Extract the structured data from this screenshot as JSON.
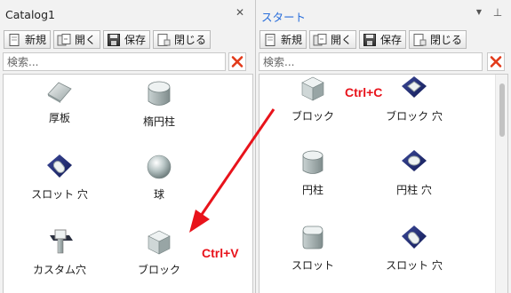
{
  "left_panel": {
    "title": "Catalog1",
    "close_glyph": "✕",
    "toolbar": [
      {
        "label": "新規",
        "icon": "new-icon"
      },
      {
        "label": "開く",
        "icon": "open-icon"
      },
      {
        "label": "保存",
        "icon": "save-icon"
      },
      {
        "label": "閉じる",
        "icon": "close-doc-icon"
      }
    ],
    "search_placeholder": "検索...",
    "items": [
      {
        "label": "厚板",
        "icon": "thick-plate-icon"
      },
      {
        "label": "楕円柱",
        "icon": "elliptic-cylinder-icon"
      },
      {
        "label": "スロット 穴",
        "icon": "slot-hole-icon"
      },
      {
        "label": "球",
        "icon": "sphere-icon"
      },
      {
        "label": "カスタム穴",
        "icon": "custom-hole-icon"
      },
      {
        "label": "ブロック",
        "icon": "block-icon"
      }
    ]
  },
  "right_panel": {
    "title": "スタート",
    "dropdown_glyph": "▼",
    "pin_glyph": "⊥",
    "toolbar": [
      {
        "label": "新規",
        "icon": "new-icon"
      },
      {
        "label": "開く",
        "icon": "open-icon"
      },
      {
        "label": "保存",
        "icon": "save-icon"
      },
      {
        "label": "閉じる",
        "icon": "close-doc-icon"
      }
    ],
    "search_placeholder": "検索...",
    "items": [
      {
        "label": "ブロック",
        "icon": "block-icon"
      },
      {
        "label": "ブロック 穴",
        "icon": "block-hole-icon"
      },
      {
        "label": "円柱",
        "icon": "cylinder-icon"
      },
      {
        "label": "円柱 穴",
        "icon": "cylinder-hole-icon"
      },
      {
        "label": "スロット",
        "icon": "slot-icon"
      },
      {
        "label": "スロット 穴",
        "icon": "slot-hole-icon"
      }
    ]
  },
  "annotations": {
    "copy": "Ctrl+C",
    "paste": "Ctrl+V",
    "color": "#e8131b"
  }
}
